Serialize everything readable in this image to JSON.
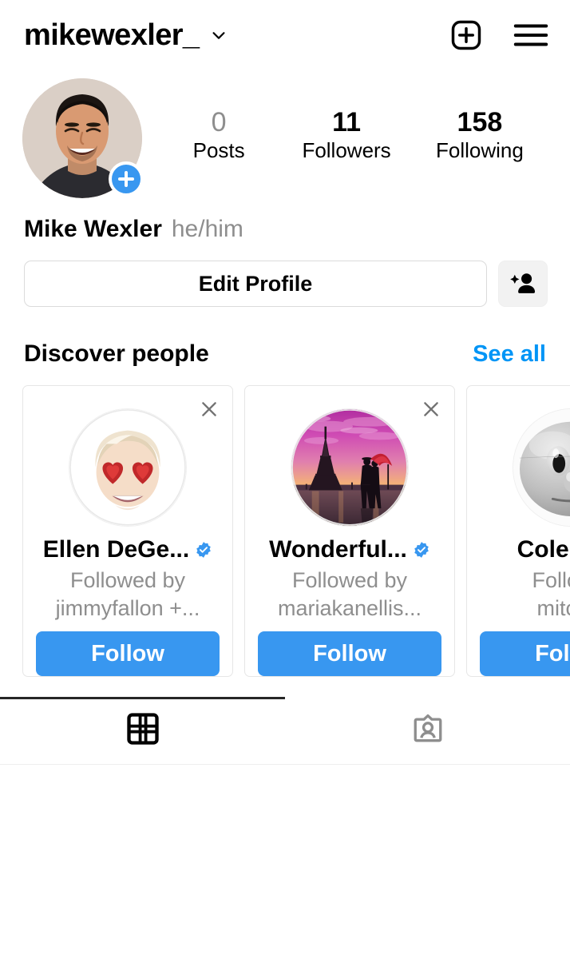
{
  "header": {
    "username": "mikewexler_",
    "chevron_icon": "chevron-down-icon",
    "new_post_icon": "plus-square-icon",
    "menu_icon": "hamburger-menu-icon"
  },
  "profile": {
    "avatar_alt": "profile-photo",
    "add_story_icon": "plus-icon",
    "stats": [
      {
        "value": "0",
        "label": "Posts",
        "dim": true
      },
      {
        "value": "11",
        "label": "Followers",
        "dim": false
      },
      {
        "value": "158",
        "label": "Following",
        "dim": false
      }
    ],
    "full_name": "Mike Wexler",
    "pronouns": "he/him",
    "edit_profile_label": "Edit Profile",
    "add_person_icon": "add-person-icon"
  },
  "discover": {
    "title": "Discover people",
    "see_all_label": "See all",
    "close_icon": "close-x-icon",
    "verified_icon": "verified-badge-icon",
    "follow_label": "Follow",
    "cards": [
      {
        "name": "Ellen DeGe...",
        "verified": true,
        "subtitle_line1": "Followed by",
        "subtitle_line2": "jimmyfallon +...",
        "avatar_type": "ellen-memoji-avatar"
      },
      {
        "name": "Wonderful...",
        "verified": true,
        "subtitle_line1": "Followed by",
        "subtitle_line2": "mariakanellis...",
        "avatar_type": "paris-eiffel-tower-avatar"
      },
      {
        "name": "Cole Be...",
        "verified": false,
        "subtitle_line1": "Follow...",
        "subtitle_line2": "mitch...",
        "avatar_type": "gray-face-avatar"
      }
    ]
  },
  "tabs": [
    {
      "icon": "grid-icon",
      "active": true
    },
    {
      "icon": "tagged-person-icon",
      "active": false
    }
  ],
  "colors": {
    "accent_blue": "#3897f0",
    "link_blue": "#0095f6",
    "muted_gray": "#8e8e8e",
    "border_gray": "#dbdbdb"
  }
}
